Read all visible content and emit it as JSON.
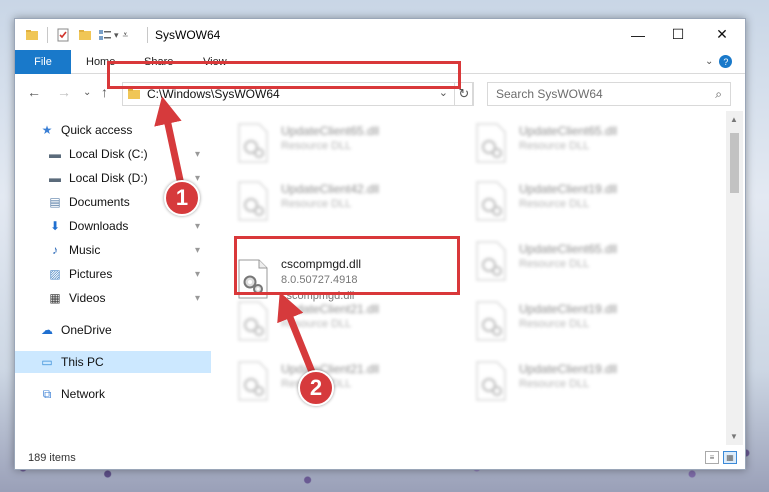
{
  "window": {
    "title": "SysWOW64",
    "minimize_glyph": "—",
    "maximize_glyph": "☐",
    "close_glyph": "✕"
  },
  "ribbon": {
    "tabs": [
      "File",
      "Home",
      "Share",
      "View"
    ],
    "expand_glyph": "⌄",
    "help_glyph": "?"
  },
  "nav": {
    "back_glyph": "←",
    "forward_glyph": "→",
    "recent_glyph": "⌄",
    "up_glyph": "↑",
    "address_path": "C:\\Windows\\SysWOW64",
    "address_dropdown_glyph": "⌄",
    "refresh_glyph": "↻",
    "search_placeholder": "Search SysWOW64",
    "search_glyph": "⌕"
  },
  "sidebar": {
    "items": [
      {
        "label": "Quick access",
        "icon": "star-icon",
        "glyph": "★",
        "color": "#3a7fd5",
        "pinned": false
      },
      {
        "label": "Local Disk (C:)",
        "icon": "drive-icon",
        "glyph": "▬",
        "color": "#5b6b7b",
        "pinned": true
      },
      {
        "label": "Local Disk (D:)",
        "icon": "drive-icon",
        "glyph": "▬",
        "color": "#5b6b7b",
        "pinned": true
      },
      {
        "label": "Documents",
        "icon": "documents-icon",
        "glyph": "▤",
        "color": "#5a7fa8",
        "pinned": true
      },
      {
        "label": "Downloads",
        "icon": "download-arrow-icon",
        "glyph": "⬇",
        "color": "#1f6fd0",
        "pinned": true
      },
      {
        "label": "Music",
        "icon": "music-note-icon",
        "glyph": "♪",
        "color": "#2c6ab8",
        "pinned": true
      },
      {
        "label": "Pictures",
        "icon": "pictures-icon",
        "glyph": "▨",
        "color": "#4b86c4",
        "pinned": true
      },
      {
        "label": "Videos",
        "icon": "film-icon",
        "glyph": "▦",
        "color": "#444",
        "pinned": true
      },
      {
        "label": "OneDrive",
        "icon": "cloud-icon",
        "glyph": "☁",
        "color": "#1f6fd0",
        "pinned": false
      },
      {
        "label": "This PC",
        "icon": "monitor-icon",
        "glyph": "▭",
        "color": "#3a8fd8",
        "pinned": false
      },
      {
        "label": "Network",
        "icon": "network-icon",
        "glyph": "⧉",
        "color": "#3a7fd5",
        "pinned": false
      }
    ],
    "pin_glyph": "📌"
  },
  "files": {
    "blurred": [
      {
        "name": "UpdateClient65.dll",
        "type": "Resource DLL"
      },
      {
        "name": "UpdateClient65.dll",
        "type": "Resource DLL"
      },
      {
        "name": "UpdateClient42.dll",
        "type": "Resource DLL"
      },
      {
        "name": "UpdateClient19.dll",
        "type": "Resource DLL"
      },
      {
        "name": "UpdateClient65.dll",
        "type": "Resource DLL"
      },
      {
        "name": "UpdateClient21.dll",
        "type": "Resource DLL"
      },
      {
        "name": "UpdateClient19.dll",
        "type": "Resource DLL"
      },
      {
        "name": "UpdateClient21.dll",
        "type": "Resource DLL"
      },
      {
        "name": "UpdateClient19.dll",
        "type": "Resource DLL"
      }
    ],
    "focused": {
      "name": "cscompmgd.dll",
      "version": "8.0.50727.4918",
      "description": "cscompmgd.dll"
    }
  },
  "status": {
    "item_count": "189 items"
  },
  "annotations": {
    "step1": "1",
    "step2": "2",
    "color": "#d63a3c"
  }
}
